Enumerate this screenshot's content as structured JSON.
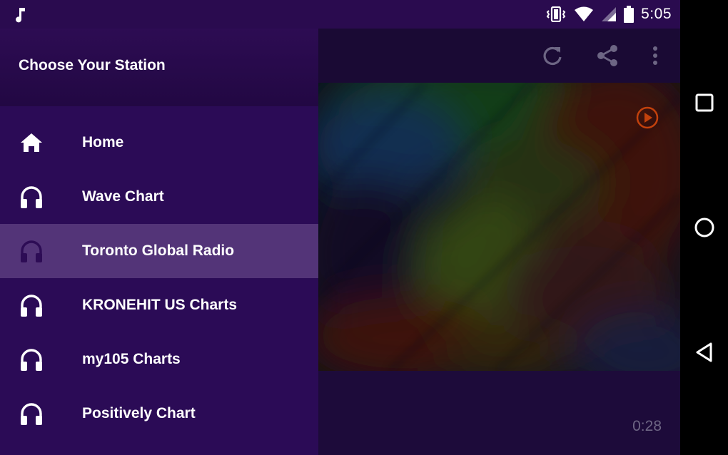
{
  "status_bar": {
    "time": "5:05",
    "icons": [
      "music-note-icon",
      "vibrate-icon",
      "wifi-icon",
      "cell-signal-icon",
      "battery-icon"
    ]
  },
  "drawer": {
    "title": "Choose Your Station",
    "items": [
      {
        "label": "Home",
        "icon": "home-icon",
        "selected": false
      },
      {
        "label": "Wave Chart",
        "icon": "headphones-icon",
        "selected": false
      },
      {
        "label": "Toronto Global Radio",
        "icon": "headphones-icon",
        "selected": true
      },
      {
        "label": "KRONEHIT US Charts",
        "icon": "headphones-icon",
        "selected": false
      },
      {
        "label": "my105 Charts",
        "icon": "headphones-icon",
        "selected": false
      },
      {
        "label": "Positively Chart",
        "icon": "headphones-icon",
        "selected": false
      }
    ]
  },
  "toolbar": {
    "icons": [
      "refresh-icon",
      "share-icon",
      "more-vert-icon"
    ]
  },
  "player": {
    "elapsed": "0:28",
    "play_icon": "play-circle-icon"
  },
  "nav_bar": {
    "icons": [
      "recents-square-icon",
      "home-circle-icon",
      "back-triangle-icon"
    ]
  },
  "colors": {
    "drawer_bg": "#2b0b56",
    "selected_bg": "#533478",
    "status_bar_bg": "#2a0b4f",
    "accent_play": "#c2410c"
  }
}
